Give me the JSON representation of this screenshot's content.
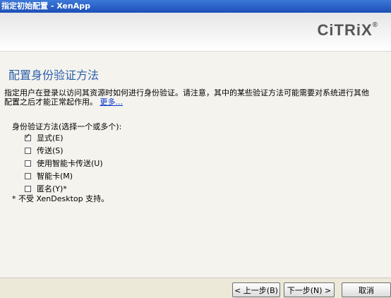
{
  "window": {
    "title": "指定初始配置 - XenApp"
  },
  "brand": {
    "logo_text": "CiTRiX",
    "logo_mark": "®"
  },
  "page": {
    "heading": "配置身份验证方法",
    "description": "指定用户在登录以访问其资源时如何进行身份验证。请注意，其中的某些验证方法可能需要对系统进行其他配置之后才能正常起作用。",
    "more_link": "更多..."
  },
  "auth": {
    "label": "身份验证方法(选择一个或多个):",
    "options": [
      {
        "label": "显式(E)",
        "checked": true
      },
      {
        "label": "传送(S)",
        "checked": false
      },
      {
        "label": "使用智能卡传送(U)",
        "checked": false
      },
      {
        "label": "智能卡(M)",
        "checked": false
      },
      {
        "label": "匿名(Y)*",
        "checked": false
      }
    ],
    "footnote": "* 不受 XenDesktop 支持。"
  },
  "buttons": {
    "back": "< 上一步(B)",
    "next": "下一步(N) >",
    "cancel": "取消"
  }
}
